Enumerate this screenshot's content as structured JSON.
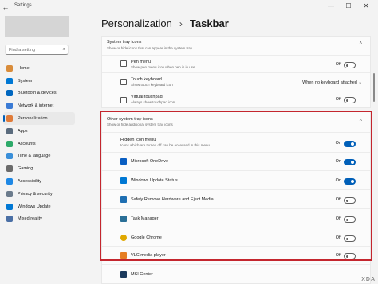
{
  "window": {
    "title": "Settings",
    "back_glyph": "←",
    "minimize_glyph": "—",
    "maximize_glyph": "☐",
    "close_glyph": "✕"
  },
  "search": {
    "placeholder": "Find a setting",
    "icon": "search-icon",
    "icon_glyph": "⌕"
  },
  "sidebar": {
    "items": [
      {
        "label": "Home",
        "icon": "home-icon",
        "color": "#d98c3a"
      },
      {
        "label": "System",
        "icon": "system-icon",
        "color": "#0078d4"
      },
      {
        "label": "Bluetooth & devices",
        "icon": "bluetooth-icon",
        "color": "#0067c0"
      },
      {
        "label": "Network & internet",
        "icon": "network-icon",
        "color": "#3a7bd5"
      },
      {
        "label": "Personalization",
        "icon": "brush-icon",
        "color": "#e07b39",
        "selected": true
      },
      {
        "label": "Apps",
        "icon": "apps-icon",
        "color": "#5a6b7d"
      },
      {
        "label": "Accounts",
        "icon": "accounts-icon",
        "color": "#2eaa6a"
      },
      {
        "label": "Time & language",
        "icon": "clock-icon",
        "color": "#3a8fd9"
      },
      {
        "label": "Gaming",
        "icon": "gaming-icon",
        "color": "#6b6b6b"
      },
      {
        "label": "Accessibility",
        "icon": "accessibility-icon",
        "color": "#1e88e5"
      },
      {
        "label": "Privacy & security",
        "icon": "shield-icon",
        "color": "#6b7b8c"
      },
      {
        "label": "Windows Update",
        "icon": "update-icon",
        "color": "#0078d4"
      },
      {
        "label": "Mixed reality",
        "icon": "mixed-reality-icon",
        "color": "#4a6fa5"
      }
    ]
  },
  "breadcrumb": {
    "parent": "Personalization",
    "separator": "›",
    "current": "Taskbar"
  },
  "system_tray": {
    "title": "System tray icons",
    "subtitle": "Show or hide icons that can appear in the system tray",
    "chevron_glyph": "˄",
    "items": [
      {
        "title": "Pen menu",
        "subtitle": "Show pen menu icon when pen is in use",
        "state": "Off",
        "on": false,
        "icon": "pen-icon"
      },
      {
        "title": "Touch keyboard",
        "subtitle": "Show touch keyboard icon",
        "dropdown": "When no keyboard attached",
        "dropdown_glyph": "⌄",
        "icon": "keyboard-icon"
      },
      {
        "title": "Virtual touchpad",
        "subtitle": "Always show touchpad icon",
        "state": "Off",
        "on": false,
        "icon": "touchpad-icon"
      }
    ]
  },
  "other_tray": {
    "title": "Other system tray icons",
    "subtitle": "Show or hide additional system tray icons",
    "chevron_glyph": "˄",
    "hidden_menu": {
      "title": "Hidden icon menu",
      "subtitle": "Icons which are turned off can be accessed in this menu",
      "state": "On",
      "on": true
    },
    "items": [
      {
        "title": "Microsoft OneDrive",
        "state": "On",
        "on": true,
        "icon": "onedrive-icon",
        "color": "#0a5ec2"
      },
      {
        "title": "Windows Update Status",
        "state": "On",
        "on": true,
        "icon": "update-status-icon",
        "color": "#0078d4"
      },
      {
        "title": "Safely Remove Hardware and Eject Media",
        "state": "Off",
        "on": false,
        "icon": "usb-icon",
        "color": "#1f6fb2"
      },
      {
        "title": "Task Manager",
        "state": "Off",
        "on": false,
        "icon": "task-manager-icon",
        "color": "#2a6f97"
      },
      {
        "title": "Google Chrome",
        "state": "Off",
        "on": false,
        "icon": "chrome-icon",
        "color": "#e0a800"
      },
      {
        "title": "VLC media player",
        "state": "Off",
        "on": false,
        "icon": "vlc-icon",
        "color": "#e67e22"
      },
      {
        "title": "MSI Center",
        "icon": "msi-icon",
        "color": "#1b3a5c"
      }
    ]
  },
  "colors": {
    "accent": "#005fb8",
    "highlight_border": "#c4262e"
  },
  "watermark": "XDA"
}
